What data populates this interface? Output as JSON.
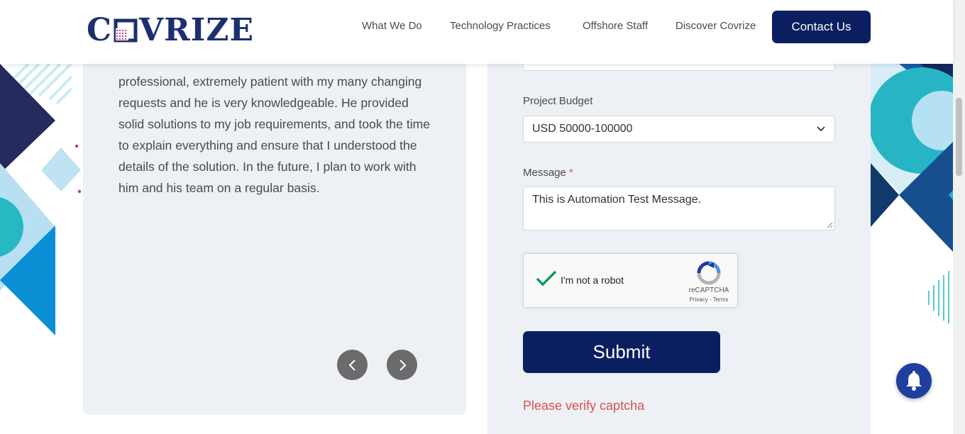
{
  "header": {
    "logo_text_left": "C",
    "logo_text_right": "VRIZE",
    "nav": [
      {
        "label": "What We Do"
      },
      {
        "label": "Technology Practices"
      },
      {
        "label": "Offshore Staff"
      },
      {
        "label": "Discover Covrize"
      }
    ],
    "contact_label": "Contact Us"
  },
  "testimonial": {
    "text": "professional, extremely patient with my many changing requests and he is very knowledgeable. He provided solid solutions to my job requirements, and took the time to explain everything and ensure that I understood the details of the solution. In the future, I plan to work with him and his team on a regular basis.",
    "prev_icon": "chevron-left-icon",
    "next_icon": "chevron-right-icon"
  },
  "form": {
    "budget_label": "Project Budget",
    "budget_value": "USD 50000-100000",
    "message_label": "Message",
    "message_required": "*",
    "message_value": "This is Automation Test Message.",
    "captcha": {
      "label": "I'm not a robot",
      "brand": "reCAPTCHA",
      "links": "Privacy - Terms",
      "checked": true
    },
    "submit_label": "Submit",
    "error_text": "Please verify captcha"
  },
  "colors": {
    "primary": "#0b1f60",
    "error": "#d9534f",
    "panel": "#edf0f5",
    "bell": "#1e3f9e"
  }
}
